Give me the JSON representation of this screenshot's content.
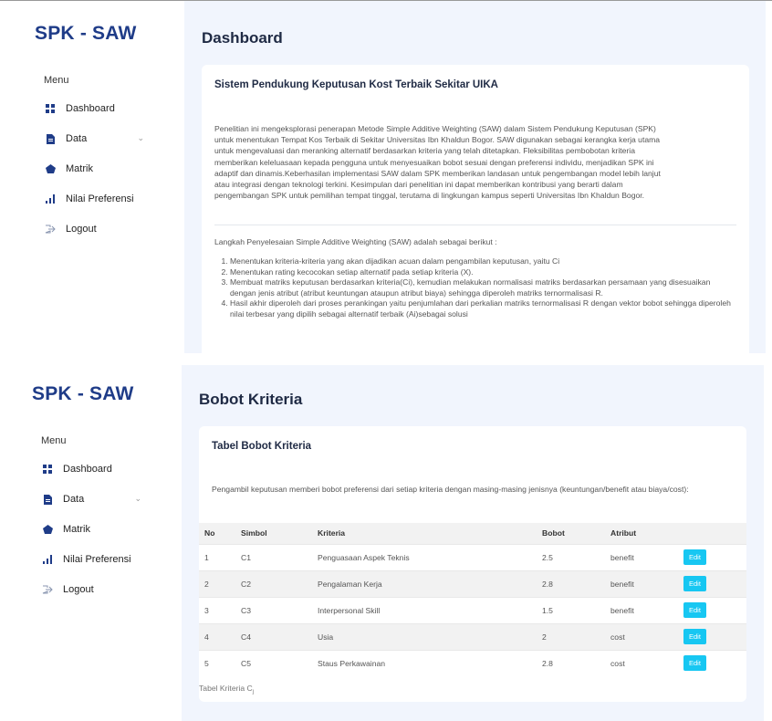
{
  "app": {
    "brand": "SPK - SAW"
  },
  "sidebar": {
    "menu_title": "Menu",
    "items": [
      {
        "label": "Dashboard",
        "icon": "grid-icon"
      },
      {
        "label": "Data",
        "icon": "document-icon",
        "has_submenu": true
      },
      {
        "label": "Matrik",
        "icon": "diamond-icon"
      },
      {
        "label": "Nilai Preferensi",
        "icon": "bar-chart-icon"
      },
      {
        "label": "Logout",
        "icon": "logout-icon"
      }
    ],
    "chevron": "⌄"
  },
  "dashboard": {
    "page_title": "Dashboard",
    "card_title": "Sistem Pendukung Keputusan Kost Terbaik Sekitar UIKA",
    "intro_lines": [
      "Penelitian ini mengeksplorasi penerapan Metode Simple Additive Weighting (SAW) dalam Sistem Pendukung Keputusan (SPK)",
      "untuk menentukan Tempat Kos Terbaik di Sekitar Universitas Ibn Khaldun Bogor. SAW digunakan sebagai kerangka kerja utama",
      "untuk mengevaluasi dan meranking alternatif berdasarkan kriteria yang telah ditetapkan. Fleksibilitas pembobotan kriteria",
      "memberikan keleluasaan kepada pengguna untuk menyesuaikan bobot sesuai dengan preferensi individu, menjadikan SPK ini",
      "adaptif dan dinamis.Keberhasilan implementasi SAW dalam SPK memberikan landasan untuk pengembangan model lebih lanjut",
      "atau integrasi dengan teknologi terkini. Kesimpulan dari penelitian ini dapat memberikan kontribusi yang berarti dalam",
      "pengembangan SPK untuk pemilihan tempat tinggal, terutama di lingkungan kampus seperti Universitas Ibn Khaldun Bogor."
    ],
    "steps_intro": "Langkah Penyelesaian Simple Additive Weighting (SAW) adalah sebagai berikut :",
    "steps": [
      "Menentukan kriteria-kriteria yang akan dijadikan acuan dalam pengambilan keputusan, yaitu Ci",
      "Menentukan rating kecocokan setiap alternatif pada setiap kriteria (X).",
      "Membuat matriks keputusan berdasarkan kriteria(Ci), kemudian melakukan normalisasi matriks berdasarkan persamaan yang disesuaikan dengan jenis atribut (atribut keuntungan ataupun atribut biaya) sehingga diperoleh matriks ternormalisasi R.",
      "Hasil akhir diperoleh dari proses perankingan yaitu penjumlahan dari perkalian matriks ternormalisasi R dengan vektor bobot sehingga diperoleh nilai terbesar yang dipilih sebagai alternatif terbaik (Ai)sebagai solusi"
    ]
  },
  "bobot": {
    "page_title": "Bobot Kriteria",
    "card_title": "Tabel Bobot Kriteria",
    "description": "Pengambil keputusan memberi bobot preferensi dari setiap kriteria dengan masing-masing jenisnya (keuntungan/benefit atau biaya/cost):",
    "columns": [
      "No",
      "Simbol",
      "Kriteria",
      "Bobot",
      "Atribut",
      ""
    ],
    "rows": [
      {
        "no": "1",
        "simbol": "C1",
        "kriteria": "Penguasaan Aspek Teknis",
        "bobot": "2.5",
        "atribut": "benefit",
        "action": "Edit"
      },
      {
        "no": "2",
        "simbol": "C2",
        "kriteria": "Pengalaman Kerja",
        "bobot": "2.8",
        "atribut": "benefit",
        "action": "Edit"
      },
      {
        "no": "3",
        "simbol": "C3",
        "kriteria": "Interpersonal Skill",
        "bobot": "1.5",
        "atribut": "benefit",
        "action": "Edit"
      },
      {
        "no": "4",
        "simbol": "C4",
        "kriteria": "Usia",
        "bobot": "2",
        "atribut": "cost",
        "action": "Edit"
      },
      {
        "no": "5",
        "simbol": "C5",
        "kriteria": "Staus Perkawainan",
        "bobot": "2.8",
        "atribut": "cost",
        "action": "Edit"
      }
    ],
    "caption_main": "Tabel Kriteria C",
    "caption_sub": "j"
  },
  "colors": {
    "brand": "#1f3c88",
    "main_bg": "#f1f5fd",
    "edit_button": "#17c7f2"
  }
}
